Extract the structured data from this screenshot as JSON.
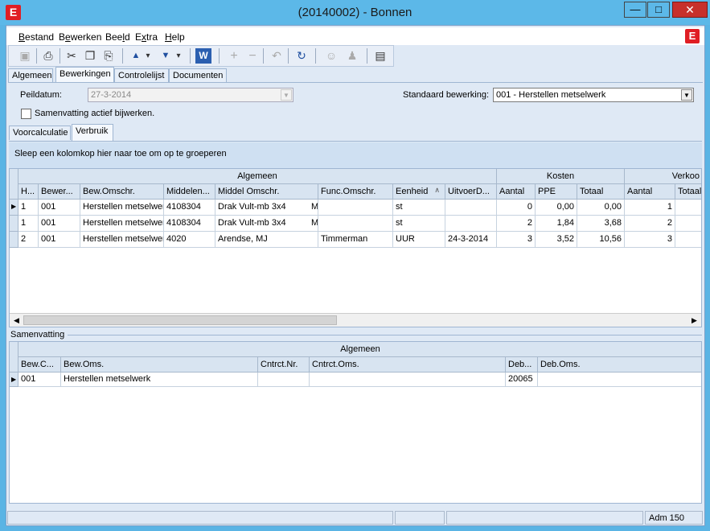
{
  "window": {
    "title": "(20140002) - Bonnen",
    "app_icon": "E",
    "minimize": "—",
    "maximize": "□",
    "close": "✕"
  },
  "menu": [
    {
      "pre": "",
      "key": "B",
      "post": "estand"
    },
    {
      "pre": "B",
      "key": "e",
      "post": "werken"
    },
    {
      "pre": "Bee",
      "key": "l",
      "post": "d"
    },
    {
      "pre": "E",
      "key": "x",
      "post": "tra"
    },
    {
      "pre": "",
      "key": "H",
      "post": "elp"
    }
  ],
  "logo": "E",
  "toolbar": {
    "save": "▣",
    "print": "⎙",
    "cut": "✂",
    "copy": "❐",
    "paste": "⎘",
    "up": "▲",
    "up_menu": "▾",
    "down": "▼",
    "down_menu": "▾",
    "word": "W",
    "add": "+",
    "remove": "−",
    "undo": "↶",
    "refresh": "↻",
    "user1": "☺",
    "user2": "♟",
    "layout": "▤"
  },
  "tabs": [
    "Algemeen",
    "Bewerkingen",
    "Controlelijst",
    "Documenten"
  ],
  "form": {
    "peildatum_label": "Peildatum:",
    "peildatum_value": "27-3-2014",
    "standaard_label": "Standaard bewerking:",
    "standaard_value": "001 - Herstellen metselwerk",
    "samenvatting_check": "Samenvatting actief bijwerken."
  },
  "subtabs": [
    "Voorcalculatie",
    "Verbruik"
  ],
  "group_hint": "Sleep een kolomkop hier naar toe om op te groeperen",
  "grid": {
    "bands": [
      "Algemeen",
      "Kosten",
      "Verkoo"
    ],
    "columns": [
      "H...",
      "Bewer...",
      "Bew.Omschr.",
      "Middelen...",
      "Middel Omschr.",
      "Func.Omschr.",
      "Eenheid",
      "UitvoerD...",
      "Aantal",
      "PPE",
      "Totaal",
      "Aantal",
      "Totaal"
    ],
    "sort_indicator": "∧",
    "rows": [
      [
        "1",
        "001",
        "Herstellen metselwer",
        "4108304",
        "Drak Vult-mb   3x4",
        "M",
        "",
        "st",
        "",
        "0",
        "0,00",
        "0,00",
        "1",
        ""
      ],
      [
        "1",
        "001",
        "Herstellen metselwer",
        "4108304",
        "Drak Vult-mb   3x4",
        "M",
        "",
        "st",
        "",
        "2",
        "1,84",
        "3,68",
        "2",
        ""
      ],
      [
        "2",
        "001",
        "Herstellen metselwer",
        "4020",
        "Arendse, MJ",
        "",
        "Timmerman",
        "UUR",
        "24-3-2014",
        "3",
        "3,52",
        "10,56",
        "3",
        ""
      ]
    ]
  },
  "samenvatting": {
    "label": "Samenvatting",
    "band": "Algemeen",
    "columns": [
      "Bew.C...",
      "Bew.Oms.",
      "Cntrct.Nr.",
      "Cntrct.Oms.",
      "Deb...",
      "Deb.Oms."
    ],
    "rows": [
      [
        "001",
        "Herstellen metselwerk",
        "",
        "",
        "20065",
        ""
      ]
    ]
  },
  "status": {
    "user": "Adm 150"
  }
}
